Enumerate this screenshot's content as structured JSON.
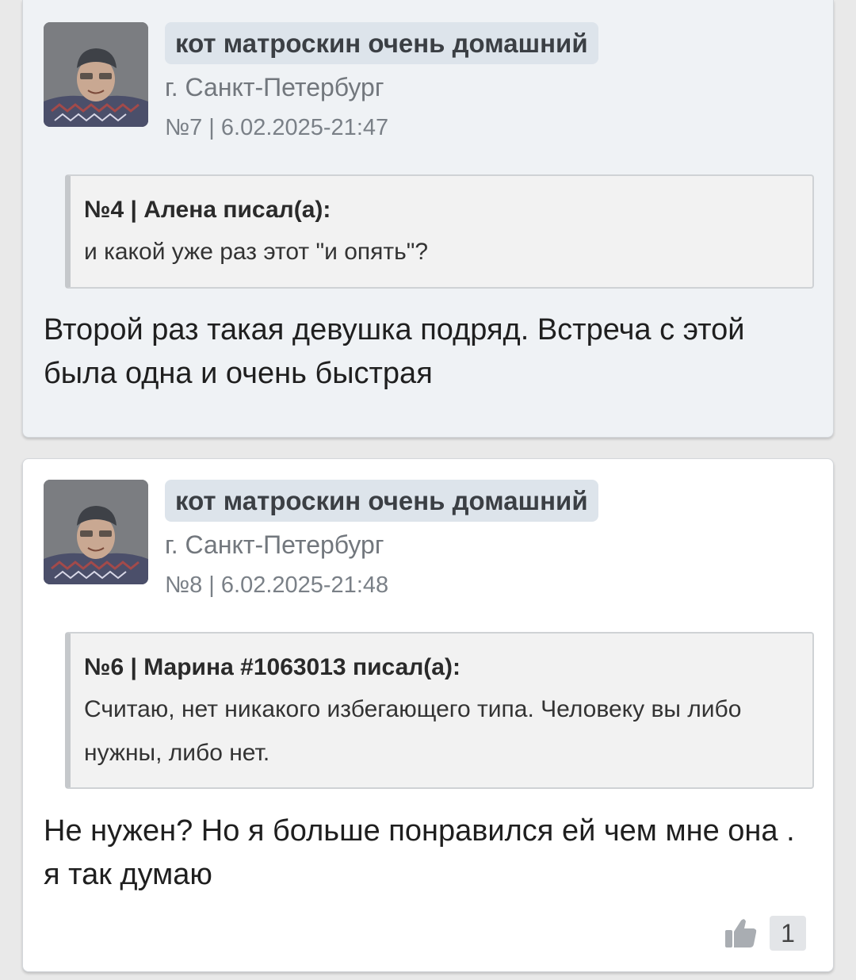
{
  "posts": [
    {
      "author": "кот матроскин очень домашний",
      "city": "г. Санкт-Петербург",
      "meta": "№7 | 6.02.2025-21:47",
      "quote_head": "№4 | Алена писал(а):",
      "quote_text": "и какой уже раз этот \"и опять\"?",
      "text": "Второй раз такая девушка подряд. Встреча с этой была одна и очень быстрая"
    },
    {
      "author": "кот матроскин очень домашний",
      "city": "г. Санкт-Петербург",
      "meta": "№8 | 6.02.2025-21:48",
      "quote_head": "№6 | Марина #1063013 писал(а):",
      "quote_text": "Считаю, нет никакого избегающего типа. Человеку вы либо нужны, либо нет.",
      "text": "Не нужен? Но я больше понравился ей чем мне она . я так думаю",
      "likes": "1",
      "like_icon": "thumbs-up-icon"
    }
  ]
}
